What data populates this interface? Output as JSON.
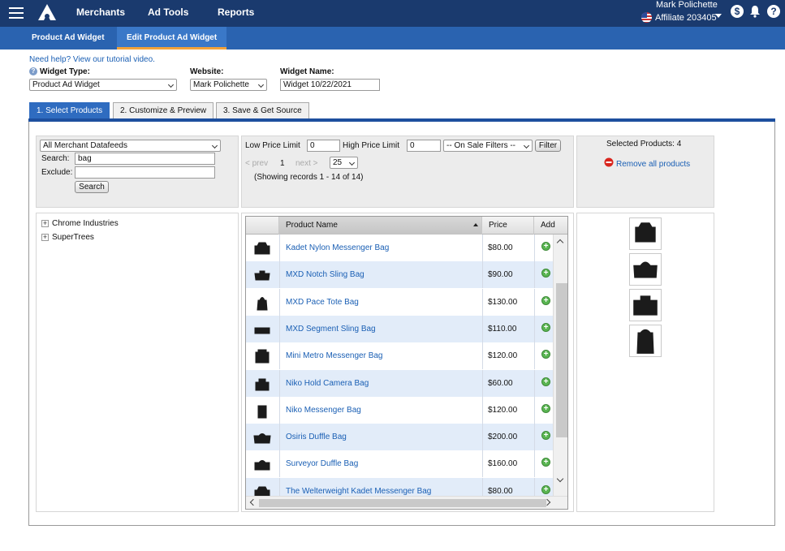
{
  "topnav": {
    "items": [
      "Merchants",
      "Ad Tools",
      "Reports"
    ],
    "user_name": "Mark Polichette",
    "affiliate": "Affiliate 203405",
    "dollar_icon_glyph": "$",
    "help_icon_glyph": "?"
  },
  "subnav": {
    "tabs": [
      "Product Ad Widget",
      "Edit Product Ad Widget"
    ],
    "active_tab": "Edit Product Ad Widget"
  },
  "form": {
    "help_text": "Need help? View our tutorial video.",
    "widget_type_label": "Widget Type:",
    "widget_type_value": "Product Ad Widget",
    "website_label": "Website:",
    "website_value": "Mark Polichette",
    "widget_name_label": "Widget Name:",
    "widget_name_value": "Widget 10/22/2021"
  },
  "steps": {
    "tabs": [
      "1. Select Products",
      "2. Customize & Preview",
      "3. Save & Get Source"
    ],
    "active": "1. Select Products"
  },
  "filters": {
    "datafeed": "All Merchant Datafeeds",
    "search_label": "Search:",
    "search_value": "bag",
    "exclude_label": "Exclude:",
    "exclude_value": "",
    "search_button": "Search"
  },
  "pricing": {
    "low_label": "Low Price Limit",
    "low_value": "0",
    "high_label": "High Price Limit",
    "high_value": "0",
    "sale_filter": "-- On Sale Filters --",
    "filter_button": "Filter",
    "prev": "< prev",
    "page": "1",
    "next": "next >",
    "per_page": "25",
    "records": "(Showing records 1 - 14 of 14)"
  },
  "selected": {
    "count_text": "Selected Products: 4",
    "remove_all": "Remove all products"
  },
  "tree": [
    "Chrome Industries",
    "SuperTrees"
  ],
  "grid": {
    "headers": [
      "Product Name",
      "Price",
      "Add"
    ],
    "rows": [
      {
        "name": "Kadet Nylon Messenger Bag",
        "price": "$80.00"
      },
      {
        "name": "MXD Notch Sling Bag",
        "price": "$90.00"
      },
      {
        "name": "MXD Pace Tote Bag",
        "price": "$130.00"
      },
      {
        "name": "MXD Segment Sling Bag",
        "price": "$110.00"
      },
      {
        "name": "Mini Metro Messenger Bag",
        "price": "$120.00"
      },
      {
        "name": "Niko Hold Camera Bag",
        "price": "$60.00"
      },
      {
        "name": "Niko Messenger Bag",
        "price": "$120.00"
      },
      {
        "name": "Osiris Duffle Bag",
        "price": "$200.00"
      },
      {
        "name": "Surveyor Duffle Bag",
        "price": "$160.00"
      },
      {
        "name": "The Welterweight Kadet Messenger Bag",
        "price": "$80.00"
      }
    ]
  },
  "colors": {
    "nav": "#1a3a6e",
    "subnav": "#2a63b0",
    "accent": "#f2a23a",
    "link": "#1a5fb4",
    "row_alt": "#e2ecf9",
    "add_icon": "#5ab552"
  }
}
